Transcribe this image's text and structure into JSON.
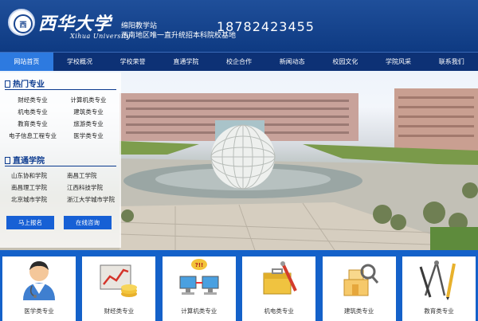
{
  "header": {
    "logo_cn": "西华大学",
    "logo_en": "Xihua University",
    "station_name": "绵阳教学站",
    "station_slogan": "西南地区唯一直升统招本科院校基地",
    "phone": "18782423455"
  },
  "nav": [
    {
      "label": "网站首页",
      "active": true
    },
    {
      "label": "学校概况"
    },
    {
      "label": "学校荣誉"
    },
    {
      "label": "直通学院"
    },
    {
      "label": "校企合作"
    },
    {
      "label": "新闻动态"
    },
    {
      "label": "校园文化"
    },
    {
      "label": "学院风采"
    },
    {
      "label": "联系我们"
    }
  ],
  "hot_majors": {
    "title": "热门专业",
    "items": [
      "财经类专业",
      "计算机类专业",
      "机电类专业",
      "建筑类专业",
      "教育类专业",
      "旅游类专业",
      "电子信息工程专业",
      "医学类专业"
    ]
  },
  "direct_colleges": {
    "title": "直通学院",
    "items": [
      "山东协和学院",
      "南昌工学院",
      "南昌理工学院",
      "江西科技学院",
      "北京城市学院",
      "浙江大学城市学院"
    ]
  },
  "buttons": {
    "signup": "马上报名",
    "consult": "在线咨询"
  },
  "categories": [
    {
      "label": "医学类专业",
      "icon": "doctor-icon"
    },
    {
      "label": "财经类专业",
      "icon": "finance-chart-icon"
    },
    {
      "label": "计算机类专业",
      "icon": "computers-icon"
    },
    {
      "label": "机电类专业",
      "icon": "toolbox-icon"
    },
    {
      "label": "建筑类专业",
      "icon": "building-blocks-icon"
    },
    {
      "label": "教育类专业",
      "icon": "drawing-tools-icon"
    }
  ],
  "colors": {
    "header_bg": "#0e3a82",
    "nav_bg": "#0d3175",
    "nav_active": "#2d7ae0",
    "accent_blue": "#1760d5",
    "category_bar": "#1461c9"
  }
}
